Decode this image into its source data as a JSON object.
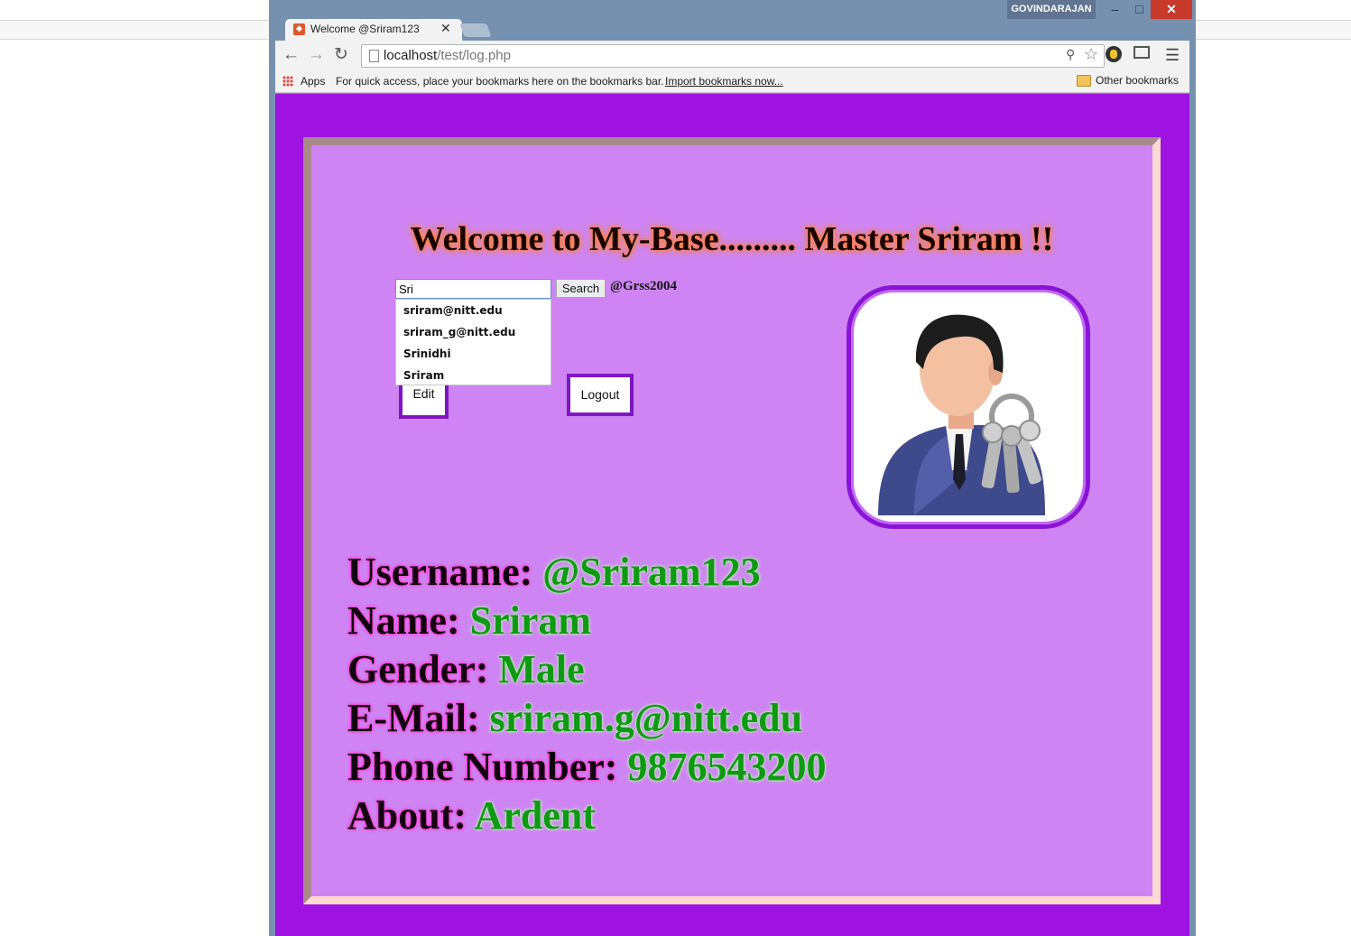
{
  "browser": {
    "user_name": "GOVINDARAJAN",
    "tab_title": "Welcome @Sriram123",
    "url_host": "localhost",
    "url_path": "/test/log.php",
    "bookmarks": {
      "apps_label": "Apps",
      "hint": "For quick access, place your bookmarks here on the bookmarks bar.",
      "import_link": "Import bookmarks now...",
      "other": "Other bookmarks"
    }
  },
  "page": {
    "welcome": "Welcome to My-Base......... Master Sriram !!",
    "search": {
      "value": "Sri",
      "button_label": "Search",
      "handle": "@Grss2004"
    },
    "suggestions": [
      "sriram@nitt.edu",
      "sriram_g@nitt.edu",
      "Srinidhi",
      "Sriram"
    ],
    "edit_label": "Edit",
    "logout_label": "Logout",
    "profile": [
      {
        "label": "Username:",
        "value": "@Sriram123"
      },
      {
        "label": "Name:",
        "value": "Sriram"
      },
      {
        "label": "Gender:",
        "value": "Male"
      },
      {
        "label": "E-Mail:",
        "value": "sriram.g@nitt.edu"
      },
      {
        "label": "Phone Number:",
        "value": "9876543200"
      },
      {
        "label": "About:",
        "value": "Ardent"
      }
    ]
  },
  "colors": {
    "page_bg": "#9f14e0",
    "panel_bg": "#ce85f3",
    "accent_border": "#7e16c4",
    "value_green": "#0e9a12"
  }
}
